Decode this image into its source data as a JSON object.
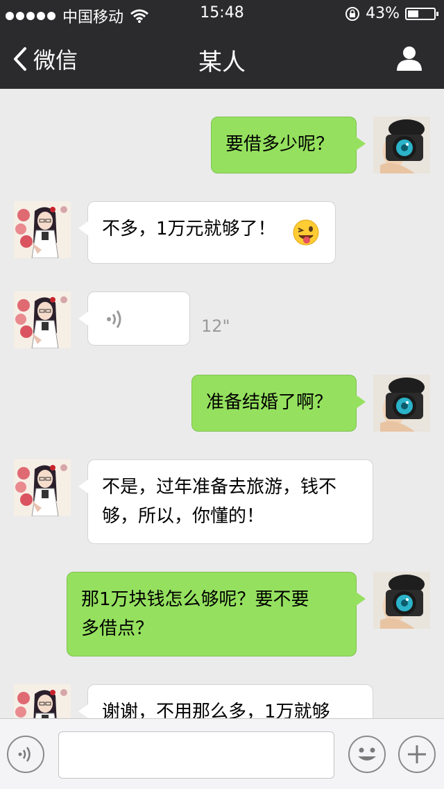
{
  "status_bar": {
    "carrier": "中国移动",
    "time": "15:48",
    "battery": "43%",
    "battery_level": 0.43
  },
  "nav": {
    "back_label": "微信",
    "title": "某人"
  },
  "messages": [
    {
      "from": "me",
      "text": "要借多少呢？"
    },
    {
      "from": "them",
      "text": "不多，1万元就够了！",
      "emoji": "winking-tongue-emoji"
    },
    {
      "from": "them",
      "type": "voice",
      "duration": "12\""
    },
    {
      "from": "me",
      "text": "准备结婚了啊？"
    },
    {
      "from": "them",
      "text_line1": "不是，过年准备去旅游，钱不",
      "text_line2": "够，所以，你懂的！"
    },
    {
      "from": "me",
      "text_line1": "那1万块钱怎么够呢？要不要",
      "text_line2": "多借点？"
    },
    {
      "from": "them",
      "text": "谢谢，不用那么多，1万就够"
    }
  ],
  "input_bar": {
    "text_value": ""
  },
  "colors": {
    "nav_background": "#2b2b2d",
    "chat_background": "#ebebeb",
    "my_bubble": "#95e15f",
    "their_bubble": "#ffffff"
  }
}
